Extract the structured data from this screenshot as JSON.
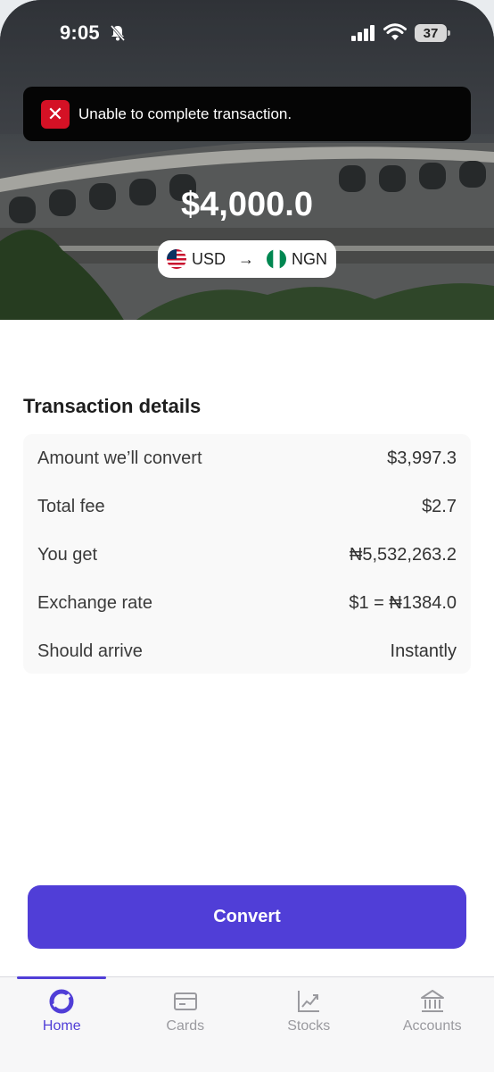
{
  "status_bar": {
    "time": "9:05",
    "battery": "37"
  },
  "toast": {
    "message": "Unable to complete transaction.",
    "icon": "close-x-icon",
    "color": "#d41125"
  },
  "hero": {
    "amount": "$4,000.0",
    "from_currency": "USD",
    "to_currency": "NGN"
  },
  "details": {
    "title": "Transaction details",
    "rows": [
      {
        "label": "Amount we’ll convert",
        "value": "$3,997.3"
      },
      {
        "label": "Total fee",
        "value": "$2.7"
      },
      {
        "label": "You get",
        "value": "₦5,532,263.2"
      },
      {
        "label": "Exchange rate",
        "value": "$1 = ₦1384.0"
      },
      {
        "label": "Should arrive",
        "value": "Instantly"
      }
    ]
  },
  "convert_button": {
    "label": "Convert",
    "color": "#503ed7"
  },
  "tabbar": {
    "items": [
      {
        "label": "Home",
        "icon": "home-logo-icon",
        "active": true
      },
      {
        "label": "Cards",
        "icon": "card-icon",
        "active": false
      },
      {
        "label": "Stocks",
        "icon": "chart-icon",
        "active": false
      },
      {
        "label": "Accounts",
        "icon": "bank-icon",
        "active": false
      }
    ]
  }
}
